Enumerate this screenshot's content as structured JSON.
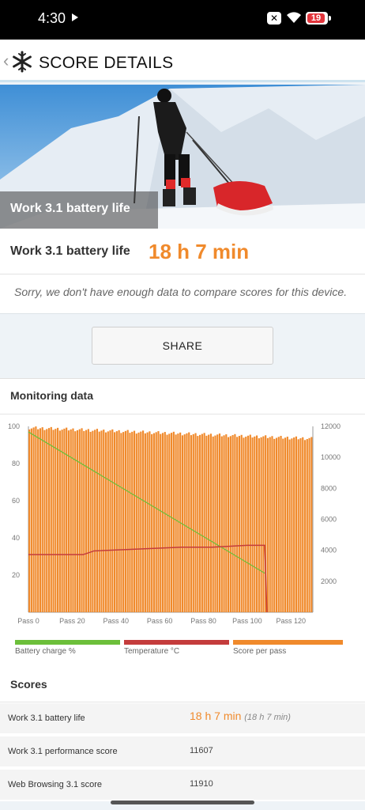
{
  "status": {
    "time": "4:30",
    "battery": "19"
  },
  "app": {
    "title": "SCORE DETAILS"
  },
  "hero": {
    "label": "Work 3.1 battery life"
  },
  "result": {
    "name": "Work 3.1 battery life",
    "value": "18 h 7 min"
  },
  "notice": "Sorry, we don't have enough data to compare scores for this device.",
  "share_label": "SHARE",
  "monitoring": {
    "title": "Monitoring data",
    "legend": [
      {
        "label": "Battery charge %",
        "color": "#6cbf3a"
      },
      {
        "label": "Temperature °C",
        "color": "#c43c3c"
      },
      {
        "label": "Score per pass",
        "color": "#f08a2c"
      }
    ]
  },
  "chart_data": {
    "type": "bar",
    "x_ticks": [
      "Pass 0",
      "Pass 20",
      "Pass 40",
      "Pass 60",
      "Pass 80",
      "Pass 100",
      "Pass 120"
    ],
    "y_left_ticks": [
      "100",
      "80",
      "60",
      "40",
      "20"
    ],
    "y_right_ticks": [
      "12000",
      "10000",
      "8000",
      "6000",
      "4000",
      "2000"
    ],
    "ylim_left": [
      0,
      100
    ],
    "ylim_right": [
      0,
      12000
    ],
    "xlim": [
      0,
      130
    ],
    "series": [
      {
        "name": "Score per pass",
        "axis": "right",
        "passes": [
          0,
          130
        ],
        "value_start": 11900,
        "value_end": 11200
      },
      {
        "name": "Battery charge %",
        "axis": "left",
        "points": [
          [
            0,
            97
          ],
          [
            108,
            21
          ]
        ]
      },
      {
        "name": "Temperature °C",
        "axis": "left",
        "points": [
          [
            0,
            31
          ],
          [
            25,
            31
          ],
          [
            30,
            33
          ],
          [
            50,
            34
          ],
          [
            70,
            35
          ],
          [
            84,
            35
          ],
          [
            100,
            36
          ],
          [
            108,
            36
          ],
          [
            109,
            0
          ]
        ]
      }
    ]
  },
  "scores": {
    "title": "Scores",
    "rows": [
      {
        "name": "Work 3.1 battery life",
        "value": "18 h 7 min",
        "sub": "(18 h 7 min)"
      },
      {
        "name": "Work 3.1 performance score",
        "value": "11607"
      },
      {
        "name": "Web Browsing 3.1 score",
        "value": "11910"
      }
    ]
  }
}
